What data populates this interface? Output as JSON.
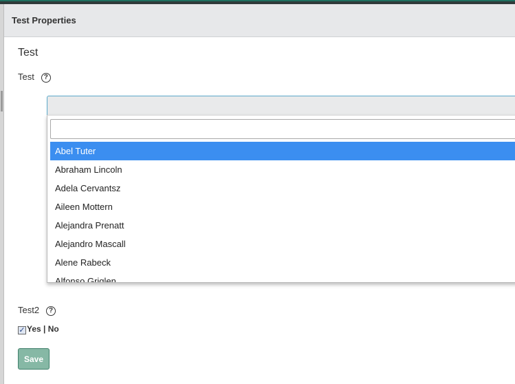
{
  "modal": {
    "title": "Test Properties"
  },
  "form": {
    "section_title": "Test",
    "field1": {
      "label": "Test",
      "help": "?"
    },
    "field2": {
      "label": "Test2",
      "help": "?"
    },
    "checkbox": {
      "checked": true,
      "mark": "✓",
      "label": "Yes | No"
    },
    "save_label": "Save"
  },
  "dropdown": {
    "search_value": "",
    "results": [
      "Abel Tuter",
      "Abraham Lincoln",
      "Adela Cervantsz",
      "Aileen Mottern",
      "Alejandra Prenatt",
      "Alejandro Mascall",
      "Alene Rabeck",
      "Alfonso Griglen"
    ],
    "highlighted_index": 0
  },
  "colors": {
    "highlight": "#3b8ef0",
    "save_button": "#86b8a5",
    "header": "#e7e8ea",
    "focus_border": "#5aa8c9"
  }
}
